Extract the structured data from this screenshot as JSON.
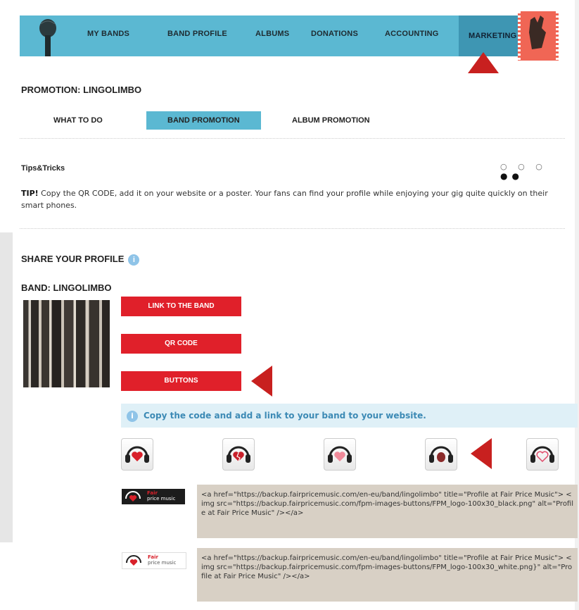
{
  "nav": {
    "items": [
      "MY BANDS",
      "BAND PROFILE",
      "ALBUMS",
      "DONATIONS",
      "ACCOUNTING",
      "MARKETING"
    ],
    "active": "MARKETING",
    "accent": "#5bb8d2",
    "active_color": "#3e96b3"
  },
  "page_title": "PROMOTION: LINGOLIMBO",
  "subtabs": [
    "WHAT TO DO",
    "BAND PROMOTION",
    "ALBUM PROMOTION"
  ],
  "tips": {
    "label": "Tips&Tricks",
    "tip_prefix": "TIP!",
    "tip_text": " Copy the QR CODE, add it on your website or a poster. Your fans can find your profile while enjoying your gig quite quickly on their smart phones."
  },
  "share_title": "SHARE YOUR PROFILE",
  "band_label": "BAND: LINGOLIMBO",
  "actions": {
    "link_label": "LINK TO THE BAND",
    "qr_label": "QR CODE",
    "buttons_label": "BUTTONS",
    "color": "#e0202a"
  },
  "info_message": "Copy the code and add a link to your band to your website.",
  "heart_buttons": [
    "headphones-heart-icon",
    "headphones-broken-heart-icon",
    "headphones-pixel-heart-icon",
    "headphones-real-heart-icon",
    "headphones-outline-heart-icon"
  ],
  "logos": [
    {
      "variant": "black",
      "brand": "Fair",
      "sub": "price music",
      "code": "<a href=\"https://backup.fairpricemusic.com/en-eu/band/lingolimbo\" title=\"Profile at Fair Price Music\"> <img src=\"https://backup.fairpricemusic.com/fpm-images-buttons/FPM_logo-100x30_black.png\" alt=\"Profile at Fair Price Music\" /></a>"
    },
    {
      "variant": "white",
      "brand": "Fair",
      "sub": "price music",
      "code": "<a href=\"https://backup.fairpricemusic.com/en-eu/band/lingolimbo\" title=\"Profile at Fair Price Music\"> <img src=\"https://backup.fairpricemusic.com/fpm-images-buttons/FPM_logo-100x30_white.png}\" alt=\"Profile at Fair Price Music\" /></a>"
    }
  ]
}
